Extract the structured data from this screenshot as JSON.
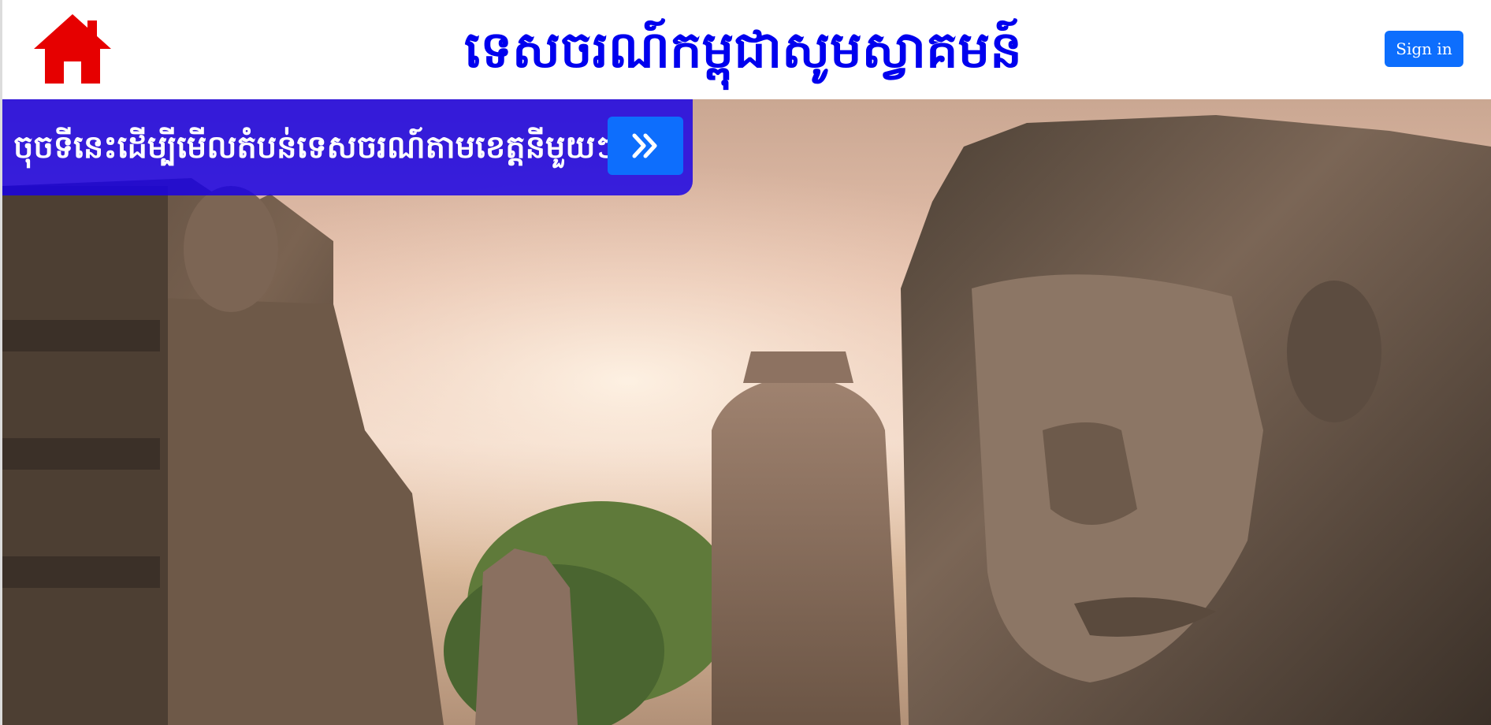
{
  "header": {
    "home_icon": "home-icon",
    "title": "ទេសចរណ៍កម្ពុជាសូមស្វាគមន៍",
    "signin_label": "Sign in"
  },
  "banner": {
    "text": "ចុចទីនេះដើម្បីមើលតំបន់ទេសចរណ៍តាមខេត្តនីមួយៗ",
    "button_icon": "double-chevron-right-icon"
  },
  "hero": {
    "image": "angkor-bayon-stone-faces"
  },
  "colors": {
    "title": "#0000ee",
    "home_icon": "#e60000",
    "primary_button": "#0d6efd",
    "banner_bg": "#1800e6"
  }
}
